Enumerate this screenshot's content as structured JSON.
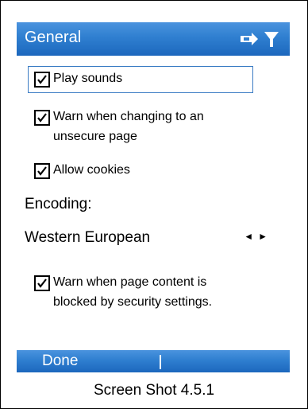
{
  "titlebar": {
    "title": "General",
    "icons": [
      "connection-icon",
      "signal-icon"
    ]
  },
  "options": [
    {
      "label_lines": [
        "Play sounds"
      ],
      "checked": true
    },
    {
      "label_lines": [
        "Warn when changing to an",
        "unsecure page"
      ],
      "checked": true
    },
    {
      "label_lines": [
        "Allow cookies"
      ],
      "checked": true
    }
  ],
  "encoding": {
    "label": "Encoding:",
    "value": "Western European",
    "arrows": "◄►"
  },
  "security_option": {
    "label_lines": [
      "Warn when page content is",
      "blocked by security settings."
    ],
    "checked": true
  },
  "softkeys": {
    "left": "Done"
  },
  "caption": "Screen Shot 4.5.1"
}
